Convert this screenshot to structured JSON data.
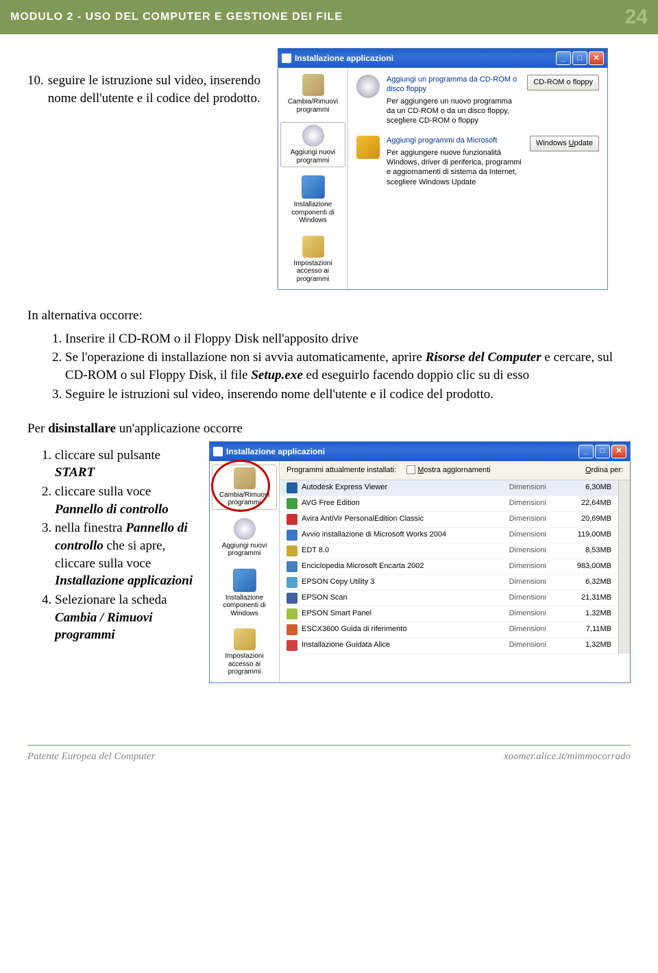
{
  "header": {
    "title": "MODULO 2 -  USO DEL COMPUTER E GESTIONE DEI FILE",
    "page": "24"
  },
  "intro": {
    "num": "10.",
    "text": "seguire le istruzione sul video, inserendo nome dell'utente e il codice del prodotto."
  },
  "win1": {
    "title": "Installazione applicazioni",
    "sidebar": [
      {
        "label": "Cambia/Rimuovi programmi"
      },
      {
        "label": "Aggiungi nuovi programmi"
      },
      {
        "label": "Installazione componenti di Windows"
      },
      {
        "label": "Impostazioni accesso ai programmi"
      }
    ],
    "sec1": {
      "title": "Aggiungi un programma da CD-ROM o disco floppy",
      "body": "Per aggiungere un nuovo programma da un CD-ROM o da un disco floppy, scegliere CD-ROM o floppy",
      "btn": "CD-ROM o floppy"
    },
    "sec2": {
      "title": "Aggiungi programmi da Microsoft",
      "body": "Per aggiungere nuove funzionalità Windows, driver di periferica, programmi e aggiornamenti di sistema da Internet, scegliere Windows Update",
      "btn": "Windows Update"
    }
  },
  "alt": {
    "lead": "In alternativa occorre:",
    "items": [
      "Inserire il CD-ROM o il Floppy Disk nell'apposito drive",
      "Se l'operazione di installazione non si avvia automaticamente, aprire <i><b>Risorse del Computer</b></i> e cercare, sul CD-ROM o sul Floppy Disk, il file <i><b>Setup.exe</b></i> ed eseguirlo facendo doppio clic su di esso",
      "Seguire le istruzioni sul video, inserendo nome dell'utente e il codice del prodotto."
    ]
  },
  "uninstall": {
    "lead_pre": "Per ",
    "lead_b": "disinstallare",
    "lead_post": " un'applicazione occorre",
    "steps": [
      "cliccare sul pulsante <i><b>START</b></i>",
      "cliccare sulla voce <i><b>Pannello di controllo</b></i>",
      "nella finestra <i><b>Pannello di controllo</b></i> che si apre, cliccare sulla voce <i><b>Installazione applicazioni</b></i>",
      "Selezionare la scheda <i><b>Cambia / Rimuovi programmi</b></i>"
    ]
  },
  "win2": {
    "title": "Installazione applicazioni",
    "toolbar": {
      "label": "Programmi attualmente installati:",
      "chk": "Mostra aggiornamenti",
      "sort": "Ordina per:"
    },
    "sizelabel": "Dimensioni",
    "programs": [
      {
        "name": "Autodesk Express Viewer",
        "size": "6,30MB",
        "c": "#2060a0"
      },
      {
        "name": "AVG Free Edition",
        "size": "22,64MB",
        "c": "#40a040"
      },
      {
        "name": "Avira AntiVir PersonalEdition Classic",
        "size": "20,69MB",
        "c": "#d03030"
      },
      {
        "name": "Avvio installazione di Microsoft Works 2004",
        "size": "119,00MB",
        "c": "#3878c8"
      },
      {
        "name": "EDT 8.0",
        "size": "8,53MB",
        "c": "#c8a830"
      },
      {
        "name": "Enciclopedia Microsoft Encarta 2002",
        "size": "983,00MB",
        "c": "#4080c0"
      },
      {
        "name": "EPSON Copy Utility 3",
        "size": "6,32MB",
        "c": "#50a0d0"
      },
      {
        "name": "EPSON Scan",
        "size": "21,31MB",
        "c": "#4060a0"
      },
      {
        "name": "EPSON Smart Panel",
        "size": "1,32MB",
        "c": "#a0c040"
      },
      {
        "name": "ESCX3600 Guida di riferimento",
        "size": "7,11MB",
        "c": "#d06030"
      },
      {
        "name": "Installazione Guidata Alice",
        "size": "1,32MB",
        "c": "#d04040"
      }
    ]
  },
  "footer": {
    "left": "Patente Europea del Computer",
    "right": "xoomer.alice.it/mimmocorrado"
  }
}
